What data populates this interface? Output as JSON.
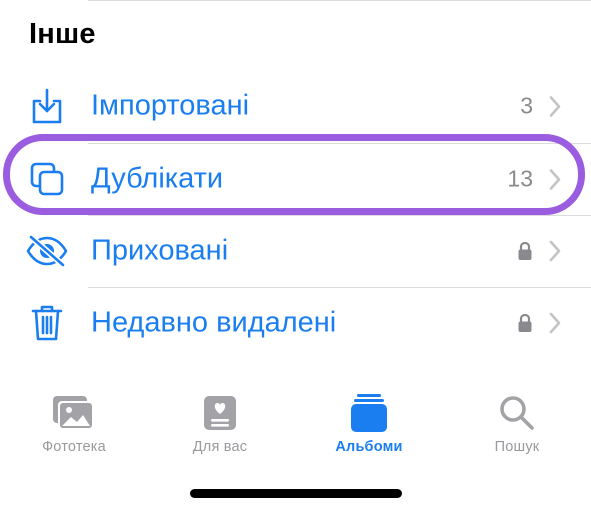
{
  "section": {
    "title": "Інше"
  },
  "rows": [
    {
      "label": "Імпортовані",
      "count": "3",
      "icon": "import-icon",
      "locked": false
    },
    {
      "label": "Дублікати",
      "count": "13",
      "icon": "duplicates-icon",
      "locked": false
    },
    {
      "label": "Приховані",
      "count": "",
      "icon": "hidden-eye-icon",
      "locked": true
    },
    {
      "label": "Недавно видалені",
      "count": "",
      "icon": "trash-icon",
      "locked": true
    }
  ],
  "tabs": [
    {
      "label": "Фототека",
      "icon": "photo-library-icon",
      "active": false
    },
    {
      "label": "Для вас",
      "icon": "for-you-icon",
      "active": false
    },
    {
      "label": "Альбоми",
      "icon": "albums-icon",
      "active": true
    },
    {
      "label": "Пошук",
      "icon": "search-icon",
      "active": false
    }
  ],
  "colors": {
    "accent": "#1a7ef0",
    "highlight": "#9b5de0",
    "secondary": "#8a8a8e",
    "inactive_tab": "#9a9a9e"
  }
}
